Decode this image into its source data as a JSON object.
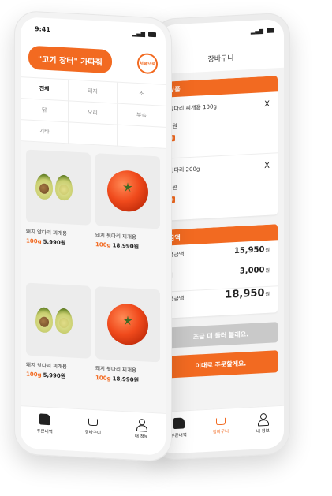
{
  "status": {
    "time": "9:41"
  },
  "menu_screen": {
    "title": "\"고기 장터\" 가따줘",
    "first_button": "처음으로",
    "categories": [
      {
        "label": "전체",
        "active": true
      },
      {
        "label": "돼지",
        "active": false
      },
      {
        "label": "소",
        "active": false
      },
      {
        "label": "닭",
        "active": false
      },
      {
        "label": "오리",
        "active": false
      },
      {
        "label": "부속",
        "active": false
      },
      {
        "label": "기타",
        "active": false
      },
      {
        "label": "",
        "active": false
      },
      {
        "label": "",
        "active": false
      }
    ],
    "products": [
      {
        "name": "돼지 앞다리 찌개용",
        "weight": "100g",
        "price": "5,990원",
        "image": "avocado"
      },
      {
        "name": "돼지 뒷다리 찌개용",
        "weight": "100g",
        "price": "18,990원",
        "image": "tomato"
      },
      {
        "name": "돼지 앞다리 찌개용",
        "weight": "100g",
        "price": "5,990원",
        "image": "avocado"
      },
      {
        "name": "돼지 뒷다리 찌개용",
        "weight": "100g",
        "price": "18,990원",
        "image": "tomato"
      }
    ],
    "tabs": [
      {
        "label": "주문내역",
        "icon": "document-icon",
        "active": false
      },
      {
        "label": "장바구니",
        "icon": "cart-icon",
        "active": false
      },
      {
        "label": "내 정보",
        "icon": "user-icon",
        "active": false
      }
    ]
  },
  "cart_screen": {
    "title": "장바구니",
    "products_header": "상품",
    "items": [
      {
        "name": "앞다리 찌개용 100g",
        "price": "0원",
        "remove": "X"
      },
      {
        "name": "뒷다리 200g",
        "price": "0원",
        "remove": "X"
      }
    ],
    "summary_header": "금액",
    "summary": [
      {
        "label": "품금액",
        "value": "15,950",
        "unit": "원"
      },
      {
        "label": "비",
        "value": "3,000",
        "unit": "원"
      }
    ],
    "total": {
      "label": "문금액",
      "value": "18,950",
      "unit": "원"
    },
    "more_button": "조금 더 둘러 볼래요.",
    "order_button": "이대로 주문할게요.",
    "tabs": [
      {
        "label": "주문내역",
        "icon": "document-icon",
        "active": false
      },
      {
        "label": "장바구니",
        "icon": "cart-icon",
        "active": true
      },
      {
        "label": "내 정보",
        "icon": "user-icon",
        "active": false
      }
    ]
  },
  "colors": {
    "accent": "#f26a21",
    "muted_button": "#c9c9c9"
  }
}
